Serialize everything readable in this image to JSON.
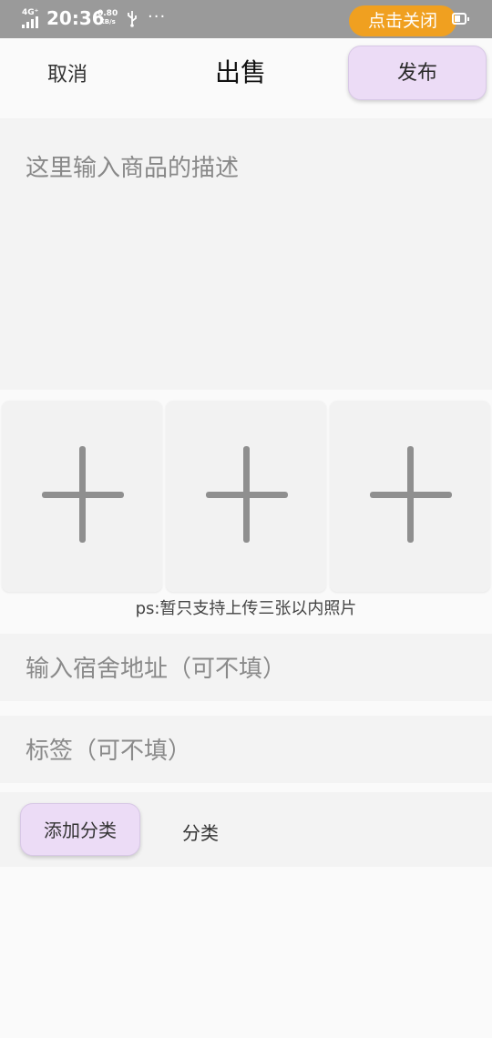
{
  "status_bar": {
    "network": "4G⁺",
    "time": "20:36",
    "speed_value": "0.80",
    "speed_unit": "KB/s",
    "more": "···",
    "close_pill": "点击关闭"
  },
  "header": {
    "cancel": "取消",
    "title": "出售",
    "publish": "发布"
  },
  "description": {
    "placeholder": "这里输入商品的描述"
  },
  "photos": {
    "slots": 3,
    "note": "ps:暂只支持上传三张以内照片"
  },
  "fields": {
    "dorm_placeholder": "输入宿舍地址（可不填）",
    "tag_placeholder": "标签（可不填）"
  },
  "category": {
    "add_button": "添加分类",
    "label": "分类"
  },
  "colors": {
    "status_bar": "#9a9a9a",
    "close_pill": "#f0a020",
    "button_bg": "#ecdcf6",
    "panel_bg": "#f3f3f3"
  }
}
